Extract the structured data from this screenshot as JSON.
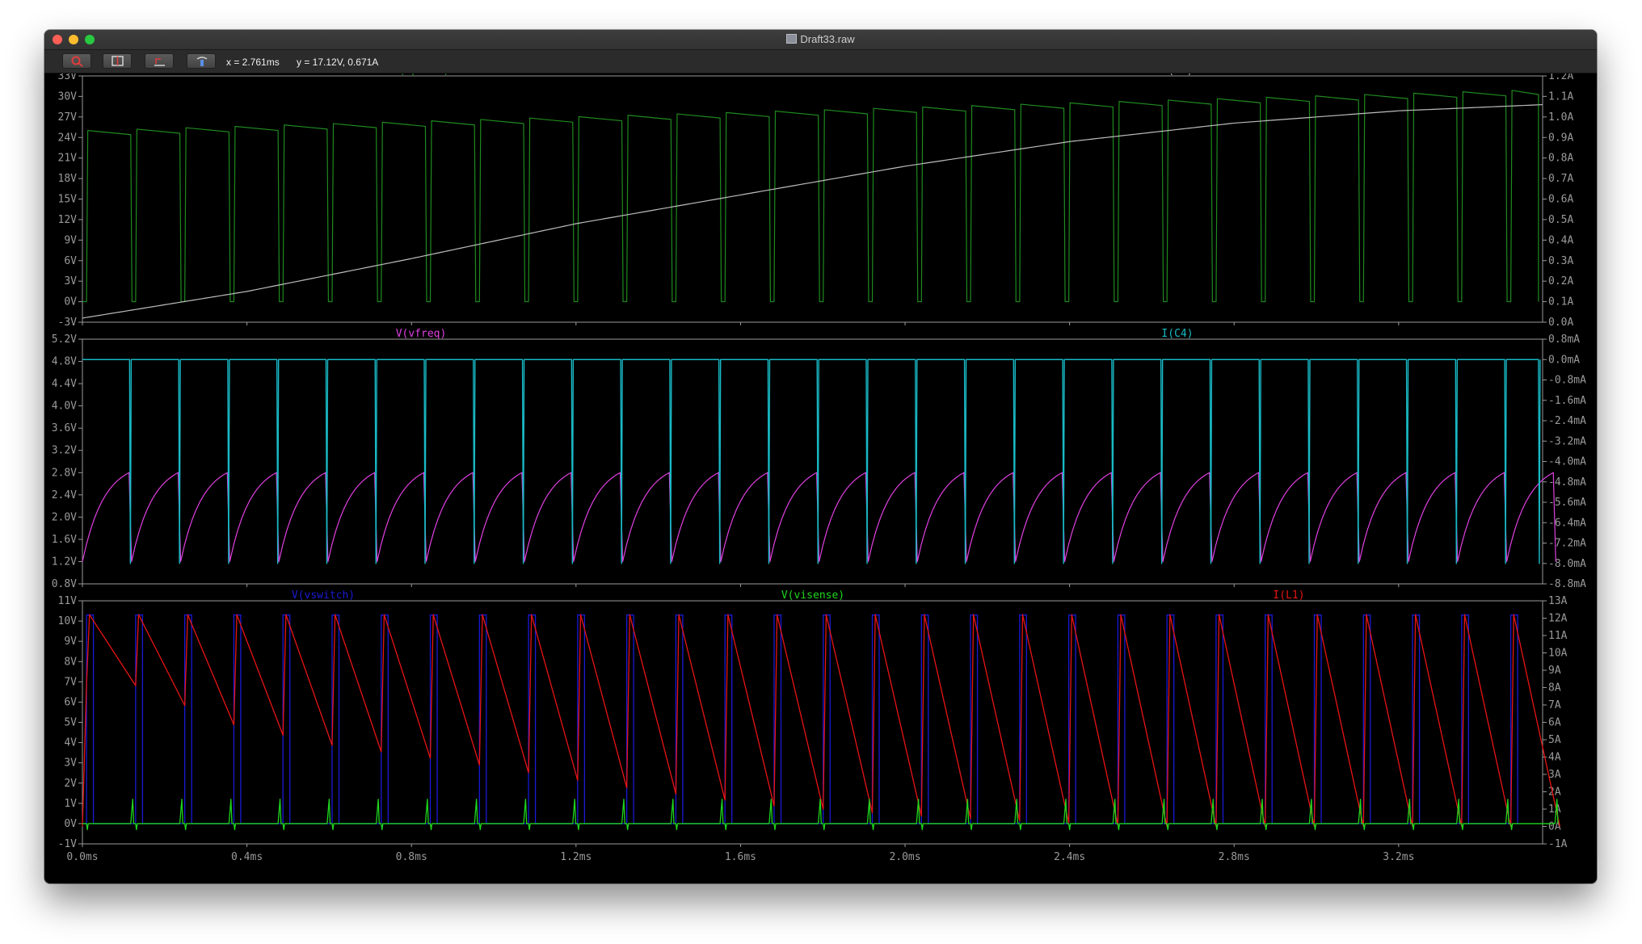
{
  "window": {
    "title": "Draft33.raw"
  },
  "toolbar": {
    "buttons": [
      {
        "label": "zoom",
        "icon": "zoom-icon"
      },
      {
        "label": "zoom-full",
        "icon": "zoom-full-icon"
      },
      {
        "label": "autorange",
        "icon": "autorange-icon"
      },
      {
        "label": "pan",
        "icon": "pan-icon"
      }
    ],
    "cursor_x": "x = 2.761ms",
    "cursor_y": "y = 17.12V, 0.671A"
  },
  "colors": {
    "vpulse": "#1f8a1f",
    "r3": "#bdbdbd",
    "vfreq": "#e040e0",
    "c4": "#19b9c5",
    "vswitch": "#1a1ad6",
    "visense": "#1fd61f",
    "l1": "#e81414",
    "axis": "#9a9a9a"
  },
  "x_axis": {
    "ticks": [
      "0.0ms",
      "0.4ms",
      "0.8ms",
      "1.2ms",
      "1.6ms",
      "2.0ms",
      "2.4ms",
      "2.8ms",
      "3.2ms"
    ],
    "tick_values": [
      0,
      0.4,
      0.8,
      1.2,
      1.6,
      2.0,
      2.4,
      2.8,
      3.2
    ],
    "range": [
      0,
      3.55
    ]
  },
  "panes": [
    {
      "traces": [
        {
          "name": "V(vpulse)",
          "color": "#1f8a1f",
          "pos": "left"
        },
        {
          "name": "I(R3)",
          "color": "#bdbdbd",
          "pos": "right"
        }
      ],
      "left_ticks": [
        "33V",
        "30V",
        "27V",
        "24V",
        "21V",
        "18V",
        "15V",
        "12V",
        "9V",
        "6V",
        "3V",
        "0V",
        "-3V"
      ],
      "right_ticks": [
        "1.2A",
        "1.1A",
        "1.0A",
        "0.9A",
        "0.8A",
        "0.7A",
        "0.6A",
        "0.5A",
        "0.4A",
        "0.3A",
        "0.2A",
        "0.1A",
        "0.0A"
      ]
    },
    {
      "traces": [
        {
          "name": "V(vfreq)",
          "color": "#e040e0",
          "pos": "left"
        },
        {
          "name": "I(C4)",
          "color": "#19b9c5",
          "pos": "right"
        }
      ],
      "left_ticks": [
        "5.2V",
        "4.8V",
        "4.4V",
        "4.0V",
        "3.6V",
        "3.2V",
        "2.8V",
        "2.4V",
        "2.0V",
        "1.6V",
        "1.2V",
        "0.8V"
      ],
      "right_ticks": [
        "0.8mA",
        "0.0mA",
        "-0.8mA",
        "-1.6mA",
        "-2.4mA",
        "-3.2mA",
        "-4.0mA",
        "-4.8mA",
        "-5.6mA",
        "-6.4mA",
        "-7.2mA",
        "-8.0mA",
        "-8.8mA"
      ]
    },
    {
      "traces": [
        {
          "name": "V(vswitch)",
          "color": "#1a1ad6",
          "pos": "left"
        },
        {
          "name": "V(visense)",
          "color": "#1fd61f",
          "pos": "center"
        },
        {
          "name": "I(L1)",
          "color": "#e81414",
          "pos": "right"
        }
      ],
      "left_ticks": [
        "11V",
        "10V",
        "9V",
        "8V",
        "7V",
        "6V",
        "5V",
        "4V",
        "3V",
        "2V",
        "1V",
        "0V",
        "-1V"
      ],
      "right_ticks": [
        "13A",
        "12A",
        "11A",
        "10A",
        "9A",
        "8A",
        "7A",
        "6A",
        "5A",
        "4A",
        "3A",
        "2A",
        "1A",
        "0A",
        "-1A"
      ]
    }
  ],
  "chart_data": [
    {
      "type": "line",
      "title": "",
      "x_unit": "ms",
      "xlim": [
        0,
        3.55
      ],
      "series": [
        {
          "name": "V(vpulse)",
          "axis": "left",
          "ylim": [
            -3,
            33
          ],
          "period_ms": 0.1194,
          "low_v": 0.0,
          "high_v_start": 25.0,
          "high_v_end": 31.0
        },
        {
          "name": "I(R3)",
          "axis": "right",
          "ylim": [
            0.0,
            1.2
          ],
          "x": [
            0.0,
            0.4,
            0.8,
            1.2,
            1.6,
            2.0,
            2.4,
            2.8,
            3.2,
            3.55
          ],
          "values": [
            0.02,
            0.15,
            0.31,
            0.48,
            0.62,
            0.76,
            0.88,
            0.97,
            1.03,
            1.06
          ]
        }
      ]
    },
    {
      "type": "line",
      "title": "",
      "x_unit": "ms",
      "xlim": [
        0,
        3.55
      ],
      "series": [
        {
          "name": "V(vfreq)",
          "axis": "left",
          "ylim": [
            0.8,
            5.2
          ],
          "period_ms": 0.1194,
          "min_v": 1.2,
          "max_v": 2.8
        },
        {
          "name": "I(C4)",
          "axis": "right",
          "ylim": [
            -8.8,
            0.8
          ],
          "period_ms": 0.1194,
          "max_ma": 0.0,
          "min_ma": -8.0
        }
      ]
    },
    {
      "type": "line",
      "title": "",
      "x_unit": "ms",
      "xlim": [
        0,
        3.55
      ],
      "series": [
        {
          "name": "V(vswitch)",
          "axis": "left",
          "ylim": [
            -1,
            11
          ],
          "period_ms": 0.1194,
          "low_v": 0.0,
          "high_v": 10.3
        },
        {
          "name": "V(visense)",
          "axis": "left",
          "ylim": [
            -1,
            11
          ],
          "period_ms": 0.1194,
          "base_v": 0.0,
          "spike_v": 1.2
        },
        {
          "name": "I(L1)",
          "axis": "right",
          "ylim": [
            -1,
            13
          ],
          "period_ms": 0.1194,
          "peak_a": 12.2,
          "valley_x": [
            0.12,
            0.36,
            0.6,
            0.95,
            1.3,
            1.67,
            2.1,
            2.6,
            3.2
          ],
          "valley_a": [
            8.2,
            5.9,
            4.7,
            3.6,
            2.3,
            1.2,
            0.5,
            0.0,
            0.0
          ]
        }
      ]
    }
  ]
}
